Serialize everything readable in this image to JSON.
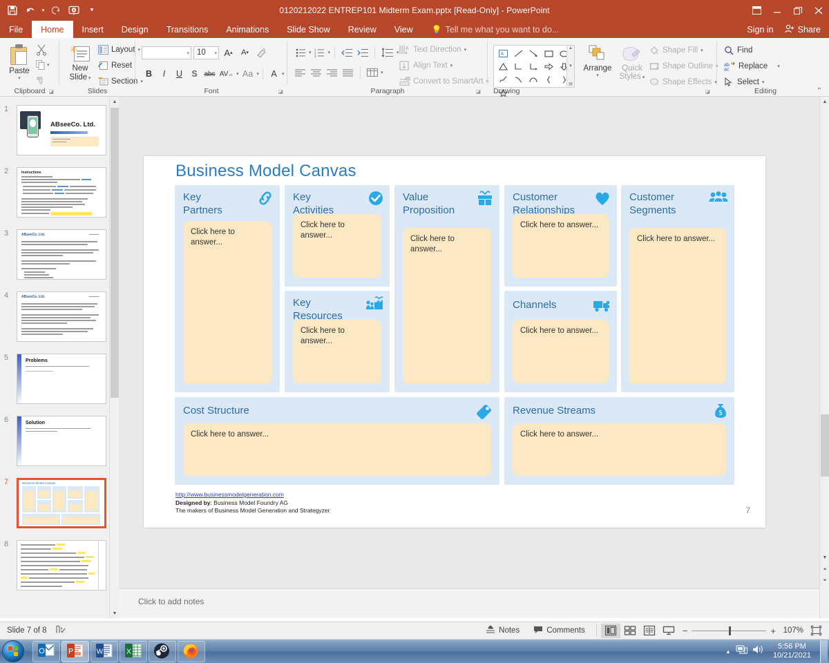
{
  "window": {
    "title": "0120212022 ENTREP101 Midterm Exam.pptx [Read-Only] - PowerPoint",
    "qat": [
      {
        "name": "save",
        "label": "Save"
      },
      {
        "name": "undo",
        "label": "Undo"
      },
      {
        "name": "redo",
        "label": "Redo"
      },
      {
        "name": "start-from-beginning",
        "label": "Start From Beginning"
      },
      {
        "name": "customize-qat",
        "label": "Customize Quick Access Toolbar"
      }
    ],
    "controls": {
      "ribbon_display": "Ribbon Display Options",
      "minimize": "Minimize",
      "restore": "Restore Down",
      "close": "Close"
    }
  },
  "ribbon": {
    "tabs": [
      {
        "label": "File",
        "active": false
      },
      {
        "label": "Home",
        "active": true
      },
      {
        "label": "Insert",
        "active": false
      },
      {
        "label": "Design",
        "active": false
      },
      {
        "label": "Transitions",
        "active": false
      },
      {
        "label": "Animations",
        "active": false
      },
      {
        "label": "Slide Show",
        "active": false
      },
      {
        "label": "Review",
        "active": false
      },
      {
        "label": "View",
        "active": false
      }
    ],
    "tell_me": "Tell me what you want to do...",
    "sign_in": "Sign in",
    "share": "Share",
    "groups": {
      "clipboard": {
        "label": "Clipboard",
        "paste": "Paste",
        "cut": "Cut",
        "copy": "Copy",
        "format_painter": "Format Painter"
      },
      "slides": {
        "label": "Slides",
        "new_slide": "New\nSlide",
        "new_slide_line1": "New",
        "new_slide_line2": "Slide",
        "layout": "Layout",
        "reset": "Reset",
        "section": "Section"
      },
      "font": {
        "label": "Font",
        "font_name": "",
        "font_name_placeholder": "",
        "font_size": "10",
        "increase_size": "A",
        "decrease_size": "A",
        "clear_formatting": "Clear All Formatting",
        "bold": "B",
        "italic": "I",
        "underline": "U",
        "shadow": "S",
        "strikethrough": "abc",
        "character_spacing": "AV",
        "change_case": "Aa",
        "font_color": "A"
      },
      "paragraph": {
        "label": "Paragraph",
        "text_direction": "Text Direction",
        "align_text": "Align Text",
        "convert_to_smartart": "Convert to SmartArt"
      },
      "drawing": {
        "label": "Drawing",
        "arrange": "Arrange",
        "quick_styles_line1": "Quick",
        "quick_styles_line2": "Styles",
        "shape_fill": "Shape Fill",
        "shape_outline": "Shape Outline",
        "shape_effects": "Shape Effects"
      },
      "editing": {
        "label": "Editing",
        "find": "Find",
        "replace": "Replace",
        "select": "Select"
      }
    }
  },
  "thumbnails": [
    {
      "number": "1",
      "title": "ABseeCo. Ltd.",
      "kind": "title-slide",
      "selected": false
    },
    {
      "number": "2",
      "title": "Instructions",
      "kind": "text-slide",
      "selected": false
    },
    {
      "number": "3",
      "title": "ABseeCo. Ltd.",
      "kind": "text-slide",
      "selected": false
    },
    {
      "number": "4",
      "title": "ABseeCo. Ltd.",
      "kind": "text-slide",
      "selected": false
    },
    {
      "number": "5",
      "title": "Problems",
      "kind": "heading-slide",
      "selected": false
    },
    {
      "number": "6",
      "title": "Solution",
      "kind": "heading-slide",
      "selected": false
    },
    {
      "number": "7",
      "title": "Business Model Canvas",
      "kind": "canvas-slide",
      "selected": true
    },
    {
      "number": "8",
      "title": "",
      "kind": "table-slide",
      "selected": false
    }
  ],
  "slide": {
    "title": "Business Model Canvas",
    "page_number": "7",
    "answer_placeholder": "Click here to answer...",
    "cells": [
      {
        "id": "key-partners",
        "title_line1": "Key",
        "title_line2": "Partners",
        "icon": "link-icon"
      },
      {
        "id": "key-activities",
        "title_line1": "Key",
        "title_line2": "Activities",
        "icon": "check-circle-icon"
      },
      {
        "id": "key-resources",
        "title_line1": "Key",
        "title_line2": "Resources",
        "icon": "factory-icon"
      },
      {
        "id": "value-proposition",
        "title_line1": "Value",
        "title_line2": "Proposition",
        "icon": "gift-icon"
      },
      {
        "id": "customer-relationships",
        "title_line1": "Customer",
        "title_line2": "Relationships",
        "icon": "heart-icon"
      },
      {
        "id": "channels",
        "title_line1": "Channels",
        "title_line2": "",
        "icon": "truck-icon"
      },
      {
        "id": "customer-segments",
        "title_line1": "Customer",
        "title_line2": "Segments",
        "icon": "people-icon"
      },
      {
        "id": "cost-structure",
        "title_line1": "Cost Structure",
        "title_line2": "",
        "icon": "price-tag-icon"
      },
      {
        "id": "revenue-streams",
        "title_line1": "Revenue Streams",
        "title_line2": "",
        "icon": "money-bag-icon"
      }
    ],
    "credits": {
      "url": "http://www.businessmodelgeneration.com",
      "designed_by_label": "Designed by",
      "designed_by_value": ": Business Model Foundry AG",
      "line3": "The makers of Business Model Generation and Strategyzer"
    },
    "colors": {
      "cell_bg": "#dbe9f7",
      "answer_bg": "#fce9c4",
      "title_blue": "#2b7cc4",
      "heading_blue": "#2d6ca8",
      "icon_blue": "#2aa8e8"
    }
  },
  "notes": {
    "placeholder": "Click to add notes"
  },
  "statusbar": {
    "slide_indicator": "Slide 7 of 8",
    "language_icon": "spell-check-icon",
    "notes": "Notes",
    "comments": "Comments",
    "views": [
      {
        "name": "normal-view",
        "label": "Normal",
        "active": true
      },
      {
        "name": "slide-sorter-view",
        "label": "Slide Sorter",
        "active": false
      },
      {
        "name": "reading-view",
        "label": "Reading View",
        "active": false
      },
      {
        "name": "slide-show-view",
        "label": "Slide Show",
        "active": false
      }
    ],
    "zoom_out": "−",
    "zoom_in": "+",
    "zoom_level": "107%",
    "fit_to_window": "Fit slide to current window"
  },
  "taskbar": {
    "start": "Start",
    "apps": [
      {
        "name": "outlook",
        "label": "Outlook",
        "state": "open"
      },
      {
        "name": "powerpoint",
        "label": "PowerPoint",
        "state": "active"
      },
      {
        "name": "word",
        "label": "Word",
        "state": "open"
      },
      {
        "name": "excel",
        "label": "Excel",
        "state": "open"
      },
      {
        "name": "steam",
        "label": "Steam",
        "state": "open"
      },
      {
        "name": "firefox",
        "label": "Firefox",
        "state": "open"
      }
    ],
    "tray": {
      "show_hidden": "Show hidden icons",
      "network": "Network",
      "volume": "Volume",
      "time": "5:56 PM",
      "date": "10/21/2021"
    }
  }
}
